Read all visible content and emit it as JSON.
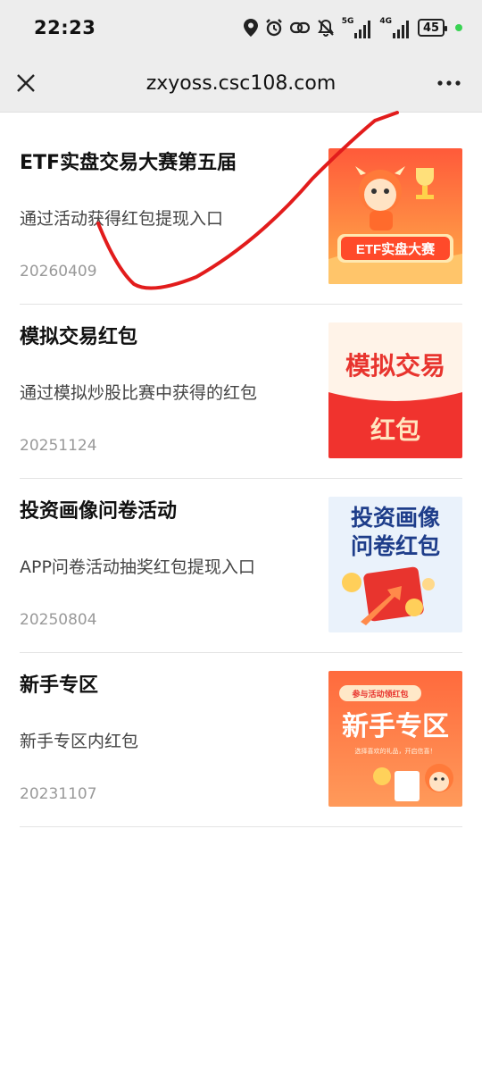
{
  "status": {
    "time": "22:23",
    "battery": "45",
    "net1": "5G",
    "net2": "4G"
  },
  "nav": {
    "title": "zxyoss.csc108.com",
    "close_icon": "close-icon",
    "more_icon": "more-icon"
  },
  "items": [
    {
      "title": "ETF实盘交易大赛第五届",
      "desc": "通过活动获得红包提现入口",
      "date": "20260409",
      "thumb_text": "ETF实盘大赛"
    },
    {
      "title": "模拟交易红包",
      "desc": "通过模拟炒股比赛中获得的红包",
      "date": "20251124",
      "thumb_text_1": "模拟交易",
      "thumb_text_2": "红包"
    },
    {
      "title": "投资画像问卷活动",
      "desc": "APP问卷活动抽奖红包提现入口",
      "date": "20250804",
      "thumb_text_1": "投资画像",
      "thumb_text_2": "问卷红包"
    },
    {
      "title": "新手专区",
      "desc": "新手专区内红包",
      "date": "20231107",
      "thumb_tag": "参与活动领红包",
      "thumb_text": "新手专区",
      "thumb_sub": "选择喜欢的礼品，开启信喜！"
    }
  ],
  "colors": {
    "accent_red": "#e8342e",
    "status_bg": "#ededed"
  }
}
